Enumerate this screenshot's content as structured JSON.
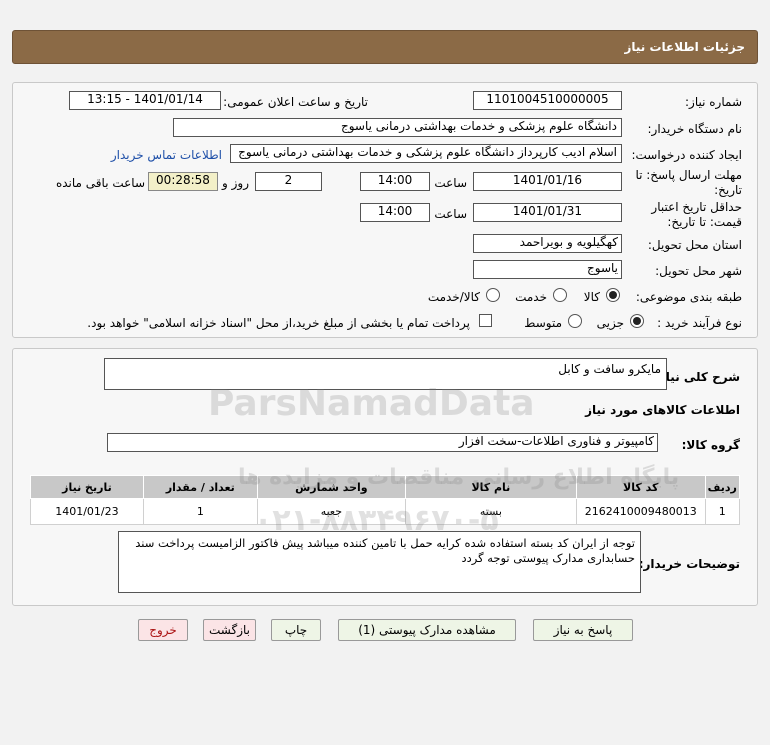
{
  "header": {
    "title": "جزئیات اطلاعات نیاز"
  },
  "fields": {
    "need_number_label": "شماره نیاز:",
    "need_number": "1101004510000005",
    "announce_label": "تاریخ و ساعت اعلان عمومی:",
    "announce_value": "1401/01/14 - 13:15",
    "buyer_org_label": "نام دستگاه خریدار:",
    "buyer_org": "دانشگاه علوم پزشکی و خدمات بهداشتی  درمانی یاسوج",
    "creator_label": "ایجاد کننده درخواست:",
    "creator": "اسلام  ادیب کارپرداز دانشگاه علوم پزشکی و خدمات بهداشتی  درمانی یاسوج",
    "contact_link": "اطلاعات تماس خریدار",
    "deadline_label_1": "مهلت ارسال پاسخ: تا",
    "deadline_label_2": "تاریخ:",
    "deadline_date": "1401/01/16",
    "time_label": "ساعت",
    "deadline_time": "14:00",
    "days_value": "2",
    "days_label": "روز و",
    "remaining_time": "00:28:58",
    "remaining_label": "ساعت باقی مانده",
    "validity_label_1": "حداقل تاریخ اعتبار",
    "validity_label_2": "قیمت: تا تاریخ:",
    "validity_date": "1401/01/31",
    "validity_time": "14:00",
    "province_label": "استان محل تحویل:",
    "province": "کهگیلویه و بویراحمد",
    "city_label": "شهر محل تحویل:",
    "city": "یاسوج",
    "category_label": "طبقه بندی موضوعی:",
    "category_options": [
      "کالا",
      "خدمت",
      "کالا/خدمت"
    ],
    "process_label": "نوع فرآیند خرید :",
    "process_options": [
      "جزیی",
      "متوسط"
    ],
    "payment_note": "پرداخت تمام یا بخشی از مبلغ خرید،از محل \"اسناد خزانه اسلامی\" خواهد بود."
  },
  "description": {
    "label": "شرح کلی نیاز:",
    "value": "مایکرو سافت و کابل",
    "goods_info_title": "اطلاعات کالاهای مورد نیاز",
    "group_label": "گروه کالا:",
    "group_value": "کامپیوتر و فناوری اطلاعات-سخت افزار"
  },
  "table": {
    "headers": [
      "ردیف",
      "کد کالا",
      "نام کالا",
      "واحد شمارش",
      "تعداد / مقدار",
      "تاریخ نیاز"
    ],
    "rows": [
      [
        "1",
        "2162410009480013",
        "",
        "بسته",
        "جعبه",
        "1",
        "1401/01/23"
      ]
    ]
  },
  "notes": {
    "label": "توضیحات خریدار:",
    "value": "توجه از ایران کد بسته استفاده شده کرایه حمل با تامین کننده میباشد پیش فاکتور الزامیست  پرداخت سند حسابداری  مدارک پیوستی توجه گردد"
  },
  "buttons": {
    "respond": "پاسخ به نیاز",
    "view_docs": "مشاهده مدارک پیوستی (1)",
    "print": "چاپ",
    "back": "بازگشت",
    "exit": "خروج"
  },
  "watermark": {
    "brand": "ParsNamadData",
    "subtitle": "پایگاه اطلاع رسانی مناقصات و مزایده ها",
    "phone": "۰۲۱-۸۸۳۴۹۶۷۰-۵"
  }
}
